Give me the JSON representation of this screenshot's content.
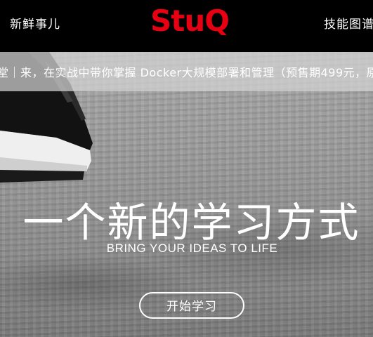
{
  "nav": {
    "left_link": "新鲜事儿",
    "right_link": "技能图谱",
    "logo_text": "StuQ",
    "logo_color": "#e60012"
  },
  "banner": {
    "text": "堂｜来，在实战中带你掌握 Docker大规模部署和管理（预售期499元，原"
  },
  "hero": {
    "title": "一个新的学习方式",
    "subtitle": "BRING YOUR IDEAS TO LIFE",
    "cta_label": "开始学习"
  },
  "colors": {
    "nav_background": "#000000",
    "brand_red": "#e60012",
    "hero_text": "#ffffff"
  }
}
